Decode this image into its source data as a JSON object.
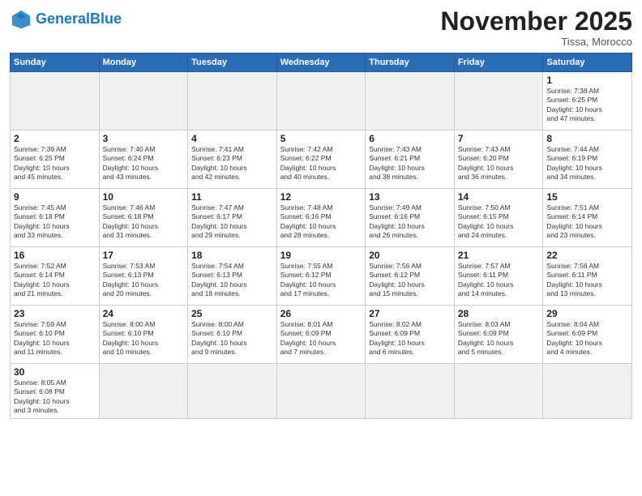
{
  "header": {
    "logo_general": "General",
    "logo_blue": "Blue",
    "month_title": "November 2025",
    "subtitle": "Tissa, Morocco"
  },
  "days_of_week": [
    "Sunday",
    "Monday",
    "Tuesday",
    "Wednesday",
    "Thursday",
    "Friday",
    "Saturday"
  ],
  "weeks": [
    [
      {
        "day": "",
        "info": "",
        "empty": true
      },
      {
        "day": "",
        "info": "",
        "empty": true
      },
      {
        "day": "",
        "info": "",
        "empty": true
      },
      {
        "day": "",
        "info": "",
        "empty": true
      },
      {
        "day": "",
        "info": "",
        "empty": true
      },
      {
        "day": "",
        "info": "",
        "empty": true
      },
      {
        "day": "1",
        "info": "Sunrise: 7:38 AM\nSunset: 6:25 PM\nDaylight: 10 hours\nand 47 minutes."
      }
    ],
    [
      {
        "day": "2",
        "info": "Sunrise: 7:39 AM\nSunset: 6:25 PM\nDaylight: 10 hours\nand 45 minutes."
      },
      {
        "day": "3",
        "info": "Sunrise: 7:40 AM\nSunset: 6:24 PM\nDaylight: 10 hours\nand 43 minutes."
      },
      {
        "day": "4",
        "info": "Sunrise: 7:41 AM\nSunset: 6:23 PM\nDaylight: 10 hours\nand 42 minutes."
      },
      {
        "day": "5",
        "info": "Sunrise: 7:42 AM\nSunset: 6:22 PM\nDaylight: 10 hours\nand 40 minutes."
      },
      {
        "day": "6",
        "info": "Sunrise: 7:43 AM\nSunset: 6:21 PM\nDaylight: 10 hours\nand 38 minutes."
      },
      {
        "day": "7",
        "info": "Sunrise: 7:43 AM\nSunset: 6:20 PM\nDaylight: 10 hours\nand 36 minutes."
      },
      {
        "day": "8",
        "info": "Sunrise: 7:44 AM\nSunset: 6:19 PM\nDaylight: 10 hours\nand 34 minutes."
      }
    ],
    [
      {
        "day": "9",
        "info": "Sunrise: 7:45 AM\nSunset: 6:18 PM\nDaylight: 10 hours\nand 33 minutes."
      },
      {
        "day": "10",
        "info": "Sunrise: 7:46 AM\nSunset: 6:18 PM\nDaylight: 10 hours\nand 31 minutes."
      },
      {
        "day": "11",
        "info": "Sunrise: 7:47 AM\nSunset: 6:17 PM\nDaylight: 10 hours\nand 29 minutes."
      },
      {
        "day": "12",
        "info": "Sunrise: 7:48 AM\nSunset: 6:16 PM\nDaylight: 10 hours\nand 28 minutes."
      },
      {
        "day": "13",
        "info": "Sunrise: 7:49 AM\nSunset: 6:16 PM\nDaylight: 10 hours\nand 26 minutes."
      },
      {
        "day": "14",
        "info": "Sunrise: 7:50 AM\nSunset: 6:15 PM\nDaylight: 10 hours\nand 24 minutes."
      },
      {
        "day": "15",
        "info": "Sunrise: 7:51 AM\nSunset: 6:14 PM\nDaylight: 10 hours\nand 23 minutes."
      }
    ],
    [
      {
        "day": "16",
        "info": "Sunrise: 7:52 AM\nSunset: 6:14 PM\nDaylight: 10 hours\nand 21 minutes."
      },
      {
        "day": "17",
        "info": "Sunrise: 7:53 AM\nSunset: 6:13 PM\nDaylight: 10 hours\nand 20 minutes."
      },
      {
        "day": "18",
        "info": "Sunrise: 7:54 AM\nSunset: 6:13 PM\nDaylight: 10 hours\nand 18 minutes."
      },
      {
        "day": "19",
        "info": "Sunrise: 7:55 AM\nSunset: 6:12 PM\nDaylight: 10 hours\nand 17 minutes."
      },
      {
        "day": "20",
        "info": "Sunrise: 7:56 AM\nSunset: 6:12 PM\nDaylight: 10 hours\nand 15 minutes."
      },
      {
        "day": "21",
        "info": "Sunrise: 7:57 AM\nSunset: 6:11 PM\nDaylight: 10 hours\nand 14 minutes."
      },
      {
        "day": "22",
        "info": "Sunrise: 7:58 AM\nSunset: 6:11 PM\nDaylight: 10 hours\nand 13 minutes."
      }
    ],
    [
      {
        "day": "23",
        "info": "Sunrise: 7:59 AM\nSunset: 6:10 PM\nDaylight: 10 hours\nand 11 minutes."
      },
      {
        "day": "24",
        "info": "Sunrise: 8:00 AM\nSunset: 6:10 PM\nDaylight: 10 hours\nand 10 minutes."
      },
      {
        "day": "25",
        "info": "Sunrise: 8:00 AM\nSunset: 6:10 PM\nDaylight: 10 hours\nand 9 minutes."
      },
      {
        "day": "26",
        "info": "Sunrise: 8:01 AM\nSunset: 6:09 PM\nDaylight: 10 hours\nand 7 minutes."
      },
      {
        "day": "27",
        "info": "Sunrise: 8:02 AM\nSunset: 6:09 PM\nDaylight: 10 hours\nand 6 minutes."
      },
      {
        "day": "28",
        "info": "Sunrise: 8:03 AM\nSunset: 6:09 PM\nDaylight: 10 hours\nand 5 minutes."
      },
      {
        "day": "29",
        "info": "Sunrise: 8:04 AM\nSunset: 6:09 PM\nDaylight: 10 hours\nand 4 minutes."
      }
    ],
    [
      {
        "day": "30",
        "info": "Sunrise: 8:05 AM\nSunset: 6:08 PM\nDaylight: 10 hours\nand 3 minutes."
      },
      {
        "day": "",
        "info": "",
        "empty": true
      },
      {
        "day": "",
        "info": "",
        "empty": true
      },
      {
        "day": "",
        "info": "",
        "empty": true
      },
      {
        "day": "",
        "info": "",
        "empty": true
      },
      {
        "day": "",
        "info": "",
        "empty": true
      },
      {
        "day": "",
        "info": "",
        "empty": true
      }
    ]
  ]
}
